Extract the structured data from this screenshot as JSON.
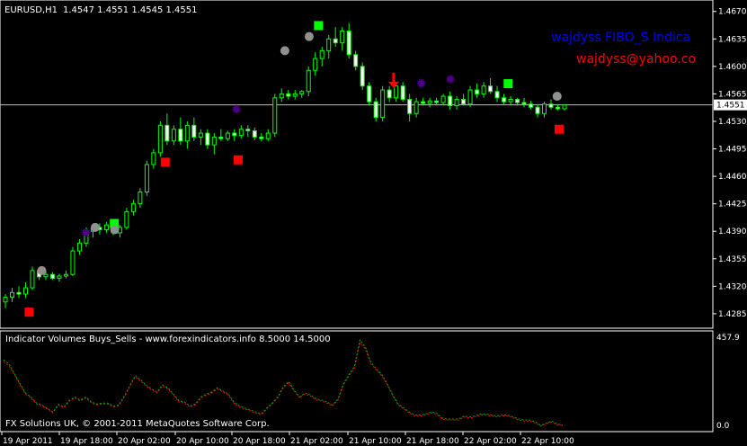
{
  "header": {
    "symbol_tf": "EURUSD,H1",
    "ohlc": "1.4547 1.4551 1.4545 1.4551"
  },
  "overlay": {
    "indicator_name": "wajdyss FIBO_S Indica",
    "indicator_email": "wajdyss@yahoo.co",
    "name_color": "#0000ff",
    "email_color": "#ff0000"
  },
  "subwindow": {
    "title": "Indicator Volumes Buys_Sells - www.forexindicators.info 8.5000 14.5000",
    "copyright": "FX Solutions UK, © 2001-2011 MetaQuotes Software Corp.",
    "scale_top": "457.9",
    "scale_bottom": "0.0"
  },
  "price_axis": {
    "labels": [
      "1.4670",
      "1.4635",
      "1.4600",
      "1.4565",
      "1.4530",
      "1.4495",
      "1.4460",
      "1.4425",
      "1.4390",
      "1.4355",
      "1.4320",
      "1.4285"
    ],
    "current_price": "1.4551"
  },
  "time_axis": {
    "labels": [
      "19 Apr 2011",
      "19 Apr 18:00",
      "20 Apr 02:00",
      "20 Apr 10:00",
      "20 Apr 18:00",
      "21 Apr 02:00",
      "21 Apr 10:00",
      "21 Apr 18:00",
      "22 Apr 02:00",
      "22 Apr 10:00"
    ]
  },
  "colors": {
    "background": "#000000",
    "candle": "#00ff00",
    "bull_body": "#000000",
    "bear_body": "#ffffff",
    "volume_buy": "#ff0000",
    "volume_sell": "#00aa00",
    "marker_red": "#ff0000",
    "marker_green": "#00ff00",
    "marker_gray": "#909090",
    "marker_purple": "#4b0082",
    "arrow": "#ff0000",
    "grid_border": "#ffffff"
  },
  "chart_data": {
    "type": "candlestick",
    "symbol": "EURUSD",
    "timeframe": "H1",
    "ylim": [
      1.427,
      1.468
    ],
    "candles": [
      [
        1.43,
        1.431,
        1.4292,
        1.4306
      ],
      [
        1.4306,
        1.4318,
        1.43,
        1.4312
      ],
      [
        1.4312,
        1.432,
        1.4305,
        1.431
      ],
      [
        1.431,
        1.4325,
        1.4305,
        1.4318
      ],
      [
        1.4318,
        1.4345,
        1.4315,
        1.434
      ],
      [
        1.434,
        1.4342,
        1.4328,
        1.4332
      ],
      [
        1.4332,
        1.434,
        1.4328,
        1.4335
      ],
      [
        1.4335,
        1.4338,
        1.4328,
        1.433
      ],
      [
        1.433,
        1.4336,
        1.4326,
        1.4333
      ],
      [
        1.4333,
        1.434,
        1.433,
        1.4335
      ],
      [
        1.4335,
        1.437,
        1.4333,
        1.4365
      ],
      [
        1.4365,
        1.438,
        1.436,
        1.4375
      ],
      [
        1.4375,
        1.4395,
        1.437,
        1.439
      ],
      [
        1.439,
        1.44,
        1.4382,
        1.4395
      ],
      [
        1.4395,
        1.44,
        1.4386,
        1.4392
      ],
      [
        1.4392,
        1.4402,
        1.4388,
        1.4398
      ],
      [
        1.4398,
        1.44,
        1.4385,
        1.4388
      ],
      [
        1.4388,
        1.4398,
        1.4382,
        1.4395
      ],
      [
        1.4395,
        1.442,
        1.4392,
        1.4415
      ],
      [
        1.4415,
        1.443,
        1.441,
        1.4425
      ],
      [
        1.4425,
        1.4445,
        1.442,
        1.444
      ],
      [
        1.444,
        1.448,
        1.4435,
        1.4475
      ],
      [
        1.4475,
        1.4495,
        1.447,
        1.449
      ],
      [
        1.449,
        1.453,
        1.4485,
        1.4525
      ],
      [
        1.4525,
        1.454,
        1.45,
        1.4505
      ],
      [
        1.4505,
        1.4525,
        1.45,
        1.452
      ],
      [
        1.452,
        1.4535,
        1.45,
        1.4505
      ],
      [
        1.4505,
        1.453,
        1.4495,
        1.4525
      ],
      [
        1.4525,
        1.4535,
        1.4505,
        1.451
      ],
      [
        1.451,
        1.452,
        1.45,
        1.4515
      ],
      [
        1.4515,
        1.452,
        1.4495,
        1.45
      ],
      [
        1.45,
        1.4515,
        1.4488,
        1.451
      ],
      [
        1.451,
        1.452,
        1.4505,
        1.4508
      ],
      [
        1.4508,
        1.4518,
        1.4505,
        1.4515
      ],
      [
        1.4515,
        1.452,
        1.4505,
        1.4512
      ],
      [
        1.4512,
        1.4525,
        1.4508,
        1.452
      ],
      [
        1.452,
        1.4525,
        1.451,
        1.4518
      ],
      [
        1.4518,
        1.4522,
        1.4506,
        1.451
      ],
      [
        1.451,
        1.4515,
        1.4505,
        1.4508
      ],
      [
        1.4508,
        1.452,
        1.4505,
        1.4515
      ],
      [
        1.4515,
        1.4565,
        1.451,
        1.456
      ],
      [
        1.456,
        1.4572,
        1.4555,
        1.4565
      ],
      [
        1.4565,
        1.457,
        1.4558,
        1.4562
      ],
      [
        1.4562,
        1.457,
        1.4558,
        1.4565
      ],
      [
        1.4565,
        1.457,
        1.456,
        1.4568
      ],
      [
        1.4568,
        1.46,
        1.4562,
        1.4595
      ],
      [
        1.4595,
        1.4618,
        1.4588,
        1.461
      ],
      [
        1.461,
        1.4625,
        1.46,
        1.462
      ],
      [
        1.462,
        1.464,
        1.461,
        1.4635
      ],
      [
        1.4635,
        1.465,
        1.4625,
        1.463
      ],
      [
        1.463,
        1.465,
        1.462,
        1.4645
      ],
      [
        1.4645,
        1.4655,
        1.461,
        1.4615
      ],
      [
        1.4615,
        1.462,
        1.4595,
        1.46
      ],
      [
        1.46,
        1.4605,
        1.457,
        1.4575
      ],
      [
        1.4575,
        1.458,
        1.455,
        1.4555
      ],
      [
        1.4555,
        1.456,
        1.453,
        1.4535
      ],
      [
        1.4535,
        1.4575,
        1.453,
        1.457
      ],
      [
        1.457,
        1.4575,
        1.4555,
        1.456
      ],
      [
        1.456,
        1.458,
        1.4555,
        1.4575
      ],
      [
        1.4575,
        1.458,
        1.4555,
        1.4558
      ],
      [
        1.4558,
        1.4565,
        1.453,
        1.454
      ],
      [
        1.454,
        1.456,
        1.4535,
        1.4555
      ],
      [
        1.4555,
        1.456,
        1.455,
        1.4553
      ],
      [
        1.4553,
        1.456,
        1.4548,
        1.4556
      ],
      [
        1.4556,
        1.456,
        1.455,
        1.4554
      ],
      [
        1.4554,
        1.4565,
        1.455,
        1.4562
      ],
      [
        1.4562,
        1.4568,
        1.4545,
        1.455
      ],
      [
        1.455,
        1.4562,
        1.4545,
        1.4558
      ],
      [
        1.4558,
        1.4565,
        1.455,
        1.4552
      ],
      [
        1.4552,
        1.4575,
        1.4548,
        1.457
      ],
      [
        1.457,
        1.4578,
        1.456,
        1.4565
      ],
      [
        1.4565,
        1.458,
        1.456,
        1.4575
      ],
      [
        1.4575,
        1.4585,
        1.4565,
        1.4568
      ],
      [
        1.4568,
        1.4575,
        1.4555,
        1.456
      ],
      [
        1.456,
        1.4565,
        1.4552,
        1.4555
      ],
      [
        1.4555,
        1.4562,
        1.455,
        1.4558
      ],
      [
        1.4558,
        1.456,
        1.455,
        1.4554
      ],
      [
        1.4554,
        1.456,
        1.4548,
        1.4552
      ],
      [
        1.4552,
        1.4556,
        1.4545,
        1.4548
      ],
      [
        1.4548,
        1.4552,
        1.4535,
        1.454
      ],
      [
        1.454,
        1.4555,
        1.4535,
        1.4552
      ],
      [
        1.4552,
        1.4558,
        1.4545,
        1.4548
      ],
      [
        1.4548,
        1.4552,
        1.4544,
        1.4546
      ],
      [
        1.4546,
        1.4552,
        1.4544,
        1.4551
      ]
    ],
    "markers": {
      "red_squares": [
        [
          1,
          1.4287
        ],
        [
          29,
          1.4478
        ],
        [
          44,
          1.4481
        ],
        [
          110,
          1.452
        ]
      ],
      "green_squares": [
        [
          20,
          1.44
        ],
        [
          62,
          1.4652
        ],
        [
          101,
          1.4578
        ]
      ],
      "gray_circles": [
        [
          6,
          1.434
        ],
        [
          17,
          1.4395
        ],
        [
          21,
          1.4392
        ],
        [
          56,
          1.462
        ],
        [
          61,
          1.4638
        ],
        [
          112,
          1.4562
        ]
      ],
      "purple_stars": [
        [
          15,
          1.4388
        ],
        [
          46,
          1.4545
        ],
        [
          84,
          1.4578
        ],
        [
          90,
          1.4583
        ]
      ],
      "down_arrows": [
        [
          78,
          1.458
        ]
      ]
    },
    "volume_series": [
      {
        "name": "buys",
        "values": [
          330,
          310,
          265,
          215,
          170,
          150,
          120,
          110,
          95,
          75,
          115,
          100,
          135,
          150,
          135,
          150,
          125,
          115,
          120,
          120,
          105,
          110,
          155,
          205,
          255,
          235,
          210,
          190,
          175,
          210,
          195,
          165,
          130,
          125,
          105,
          115,
          150,
          165,
          175,
          195,
          180,
          165,
          125,
          105,
          95,
          85,
          75,
          65,
          95,
          120,
          150,
          200,
          225,
          185,
          150,
          170,
          160,
          140,
          135,
          125,
          110,
          140,
          215,
          260,
          300,
          425,
          395,
          320,
          290,
          260,
          215,
          160,
          115,
          95,
          75,
          60,
          60,
          65,
          75,
          70,
          45,
          40,
          40,
          40,
          55,
          50,
          55,
          65,
          65,
          60,
          55,
          60,
          60,
          50,
          40,
          35,
          35,
          25,
          10,
          20,
          30,
          15,
          12
        ]
      },
      {
        "name": "sells",
        "values": [
          340,
          320,
          270,
          220,
          175,
          155,
          125,
          115,
          98,
          80,
          118,
          105,
          138,
          155,
          140,
          155,
          130,
          120,
          125,
          125,
          110,
          115,
          160,
          210,
          262,
          240,
          215,
          195,
          180,
          215,
          200,
          170,
          135,
          130,
          110,
          120,
          155,
          170,
          180,
          200,
          185,
          170,
          130,
          110,
          100,
          90,
          80,
          70,
          100,
          125,
          155,
          205,
          232,
          190,
          155,
          175,
          165,
          145,
          140,
          130,
          115,
          145,
          222,
          268,
          308,
          440,
          405,
          328,
          296,
          266,
          220,
          165,
          120,
          100,
          80,
          65,
          65,
          70,
          80,
          75,
          50,
          45,
          45,
          45,
          60,
          55,
          60,
          70,
          70,
          65,
          60,
          65,
          65,
          55,
          45,
          40,
          40,
          30,
          14,
          24,
          35,
          20,
          15
        ]
      }
    ]
  }
}
